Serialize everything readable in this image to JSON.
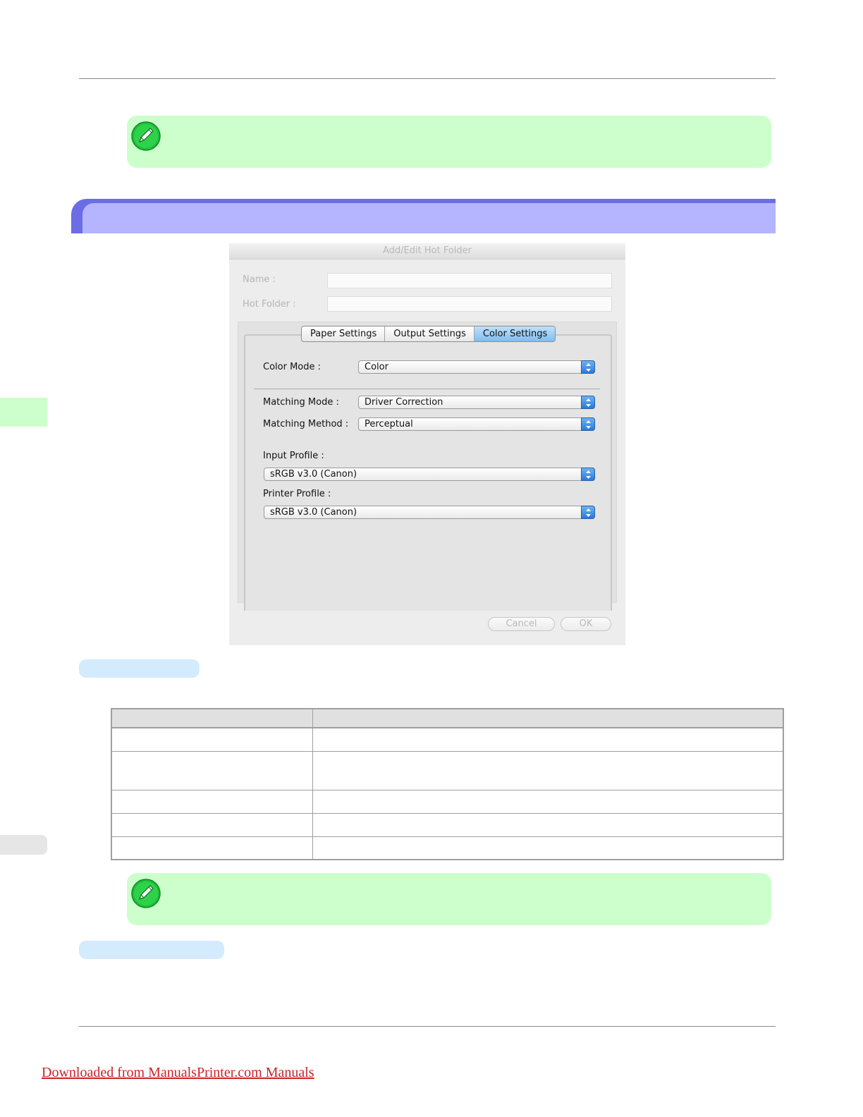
{
  "dialog": {
    "title": "Add/Edit Hot Folder",
    "name_label": "Name :",
    "name_value": "",
    "hot_folder_label": "Hot Folder :",
    "hot_folder_value": "",
    "tabs": [
      {
        "label": "Paper Settings",
        "active": false
      },
      {
        "label": "Output Settings",
        "active": false
      },
      {
        "label": "Color Settings",
        "active": true
      }
    ],
    "color_mode_label": "Color Mode :",
    "color_mode_value": "Color",
    "matching_mode_label": "Matching Mode :",
    "matching_mode_value": "Driver Correction",
    "matching_method_label": "Matching Method :",
    "matching_method_value": "Perceptual",
    "input_profile_label": "Input Profile :",
    "input_profile_value": "sRGB v3.0 (Canon)",
    "printer_profile_label": "Printer Profile :",
    "printer_profile_value": "sRGB v3.0 (Canon)",
    "cancel_label": "Cancel",
    "ok_label": "OK"
  },
  "icons": {
    "note": "pencil-note-icon",
    "select_arrows": "up-down-arrows-icon"
  },
  "colors": {
    "note_bg": "#ccffcc",
    "section_dark": "#6c6ce6",
    "section_light": "#b4b4ff",
    "subsection_pill": "#d4ebfd",
    "link": "#cc2222"
  },
  "footer": {
    "download_link": "Downloaded from ManualsPrinter.com Manuals"
  }
}
